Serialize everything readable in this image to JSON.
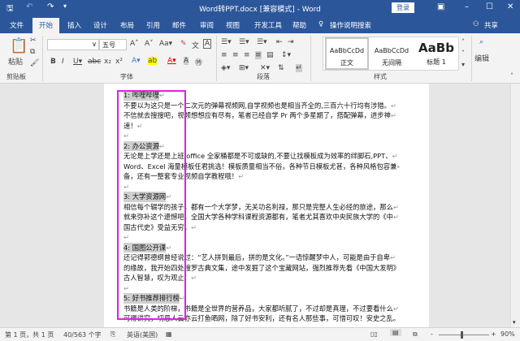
{
  "title": "Word转PPT.docx [兼容模式] - Word",
  "login": "登录",
  "tabs": [
    "文件",
    "开始",
    "插入",
    "设计",
    "布局",
    "引用",
    "邮件",
    "审阅",
    "视图",
    "开发工具",
    "帮助"
  ],
  "search": "操作说明搜索",
  "share": "共享",
  "ribbon": {
    "paste": "粘贴",
    "clipboard": "剪贴板",
    "font_size": "五号",
    "font": "字体",
    "paragraph": "段落",
    "styles_group": "样式",
    "edit": "编辑",
    "styles": [
      {
        "preview": "AaBbCcDd",
        "name": "正文"
      },
      {
        "preview": "AaBbCcDd",
        "name": "无间隔"
      },
      {
        "preview": "AaBb",
        "name": "标题 1"
      }
    ]
  },
  "doc": {
    "lines": [
      {
        "h": "1: 哔哩哔哩"
      },
      {
        "t": "不要以为这只是一个二次元的弹幕视频网,自学视频也是相当齐全的,三百六十行均有涉猎。"
      },
      {
        "t": "不信就去搜搜吧，视频想想应有尽有，笔者已经自学 Pr 两个多星期了，搭配弹幕，进步神"
      },
      {
        "t": "速！"
      },
      {
        "t": ""
      },
      {
        "h": "2: 办公资源"
      },
      {
        "t": "无论是上学还是上班,office 全家桶都是不可或缺的,不要让找模板成为效率的绊脚石,PPT、"
      },
      {
        "t": "Word、Excel 海量模板任君挑选！模板质量相当不俗，各种节日模板尤甚，各种风格包容兼"
      },
      {
        "t": "备，还有一整套专业视频自学教程哦！"
      },
      {
        "t": ""
      },
      {
        "h": "3: 大学资源网"
      },
      {
        "t": "相信每个辍学的孩子，都有一个大学梦，无关功名利禄，那只是完整人生必经的旅途，那么"
      },
      {
        "t": "就来弥补这个遗憾吧，全国大学各种学科课程资源都有，笔者尤其喜欢中央民族大学的《中"
      },
      {
        "t": "国古代史》受益无穷。"
      },
      {
        "t": ""
      },
      {
        "h": "4: 国图公开课"
      },
      {
        "t": "还记得郭德纲曾经说过：“艺人拼到最后，拼的是文化。”一语惊醒梦中人，可能是由于自卑"
      },
      {
        "t": "的缘故，我开始四处搜罗古典文集，途中发掘了这个宝藏网站，强烈推荐先看《中国大发明》"
      },
      {
        "t": "古人智慧，叹为观止！"
      },
      {
        "t": ""
      },
      {
        "h": "5: 好书推荐排行榜"
      },
      {
        "t": "书籍是人类的阶梯，书籍是全世界的营养品，大家都听腻了，不过却是真理，不过要看什么"
      },
      {
        "t": "可得讲究，切忌人云亦云打鱼晒网，除了好书安利，还有名人那些事，可惜可叹！安史之乱。"
      },
      {
        "t": ""
      }
    ]
  },
  "status": {
    "page": "第 1 页，共 1 页",
    "words": "40/563 个字",
    "lang": "英语(美国)",
    "zoom": "90%"
  },
  "zoom_fraction": 0.9
}
